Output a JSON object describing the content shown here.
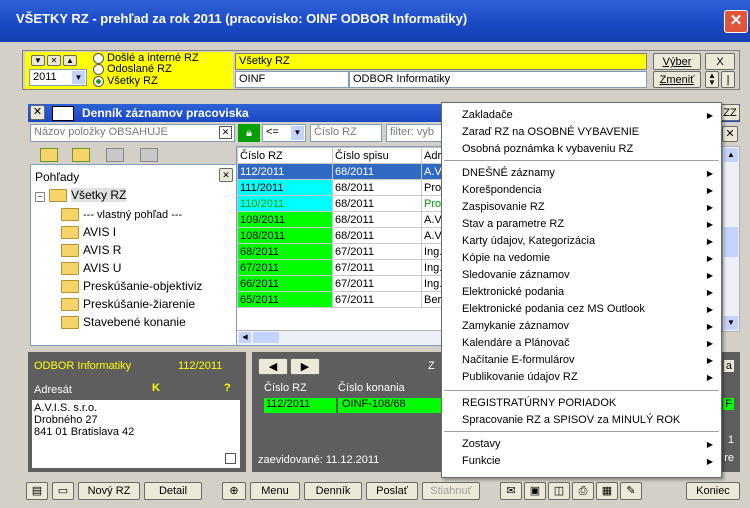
{
  "window": {
    "title": "VŠETKY RZ - prehľad za rok 2011 (pracovisko: OINF ODBOR Informatiky)"
  },
  "filter": {
    "options": [
      "Došlé a interné RZ",
      "Odoslané RZ",
      "Všetky RZ"
    ],
    "year": "2011",
    "scope_value": "Všetky RZ",
    "dept_code": "OINF",
    "dept_name": "ODBOR Informatiky",
    "select_btn": "Výber",
    "change_btn": "Zmeniť",
    "close_btn": "X"
  },
  "journal": {
    "title": "Denník záznamov pracoviska",
    "search_placeholder": "Názov položky OBSAHUJE",
    "operator": "<=",
    "number_placeholder": "Číslo RZ",
    "filter_placeholder": "filter: vyb"
  },
  "tree": {
    "header": "Pohľady",
    "root": "Všetky RZ",
    "items": [
      "--- vlastný pohľad ---",
      "AVIS I",
      "AVIS R",
      "AVIS U",
      "Preskúšanie-objektiviz",
      "Preskúšanie-žiarenie",
      "Stavebené konanie"
    ]
  },
  "table": {
    "columns": [
      "Číslo RZ",
      "Číslo spisu",
      "Adr"
    ],
    "rows": [
      {
        "rz": "112/2011",
        "spis": "68/2011",
        "adr": "A.V",
        "color": "#316ac5",
        "text": "#ffffff"
      },
      {
        "rz": "111/2011",
        "spis": "68/2011",
        "adr": "Proj",
        "color": "#00ffff",
        "text": "#000000"
      },
      {
        "rz": "110/2011",
        "spis": "68/2011",
        "adr": "Proj",
        "color": "#00ffff",
        "text": "#00a000"
      },
      {
        "rz": "109/2011",
        "spis": "68/2011",
        "adr": "A.V",
        "color": "#00ff00",
        "text": "#000000"
      },
      {
        "rz": "108/2011",
        "spis": "68/2011",
        "adr": "A.V",
        "color": "#00ff00",
        "text": "#000000"
      },
      {
        "rz": "68/2011",
        "spis": "67/2011",
        "adr": "Ing.",
        "color": "#00ff00",
        "text": "#000000"
      },
      {
        "rz": "67/2011",
        "spis": "67/2011",
        "adr": "Ing.",
        "color": "#00ff00",
        "text": "#000000"
      },
      {
        "rz": "66/2011",
        "spis": "67/2011",
        "adr": "Ing.",
        "color": "#00ff00",
        "text": "#000000"
      },
      {
        "rz": "65/2011",
        "spis": "67/2011",
        "adr": "Ber",
        "color": "#00ff00",
        "text": "#000000"
      }
    ]
  },
  "detail": {
    "dept": "ODBOR Informatiky",
    "number": "112/2011",
    "addressee_label": "Adresát",
    "k": "K",
    "q": "?",
    "address": [
      "A.V.I.S. s.r.o.",
      "Drobného 27",
      "841 01  Bratislava 42"
    ]
  },
  "record": {
    "rz_label": "Číslo RZ",
    "rz": "112/2011",
    "konanie_label": "Číslo konania",
    "konanie": "OINF-108/68",
    "registered": "zaevidované:  11.12.2011",
    "z": "Z",
    "right_letters": [
      "a",
      "F",
      "1",
      "re"
    ]
  },
  "menu": {
    "items": [
      {
        "label": "Zakladače",
        "sub": true
      },
      {
        "label": "Zaraď RZ na OSOBNÉ VYBAVENIE",
        "sub": false
      },
      {
        "label": "Osobná poznámka k vybaveniu RZ",
        "sub": false
      },
      {
        "label": "DNEŠNÉ záznamy",
        "sub": true
      },
      {
        "label": "Korešpondencia",
        "sub": true
      },
      {
        "label": "Zaspisovanie RZ",
        "sub": true
      },
      {
        "label": "Stav a parametre RZ",
        "sub": true
      },
      {
        "label": "Karty údajov, Kategorizácia",
        "sub": true
      },
      {
        "label": "Kópie na vedomie",
        "sub": true
      },
      {
        "label": "Sledovanie záznamov",
        "sub": true
      },
      {
        "label": "Elektronické podania",
        "sub": true
      },
      {
        "label": "Elektronické podania cez MS Outlook",
        "sub": true
      },
      {
        "label": "Zamykanie záznamov",
        "sub": true
      },
      {
        "label": "Kalendáre a Plánovač",
        "sub": true
      },
      {
        "label": "Načítanie E-formulárov",
        "sub": true
      },
      {
        "label": "Publikovanie údajov RZ",
        "sub": true
      },
      {
        "label": "REGISTRATÚRNY PORIADOK",
        "sub": false
      },
      {
        "label": "Spracovanie RZ a SPISOV za MINULÝ ROK",
        "sub": false
      },
      {
        "label": "Zostavy",
        "sub": true
      },
      {
        "label": "Funkcie",
        "sub": true
      }
    ]
  },
  "toolbar": {
    "new_rz": "Nový RZ",
    "detail": "Detail",
    "menu": "Menu",
    "dennik": "Denník",
    "poslat": "Poslať",
    "stiahnut": "Stiahnuť",
    "koniec": "Koniec"
  },
  "colors": {
    "title": "#1a48c4",
    "highlight_yellow": "#ffff00",
    "selected_row": "#316ac5",
    "green": "#00ff00",
    "cyan": "#00ffff",
    "dark": "#5e5e5e"
  }
}
